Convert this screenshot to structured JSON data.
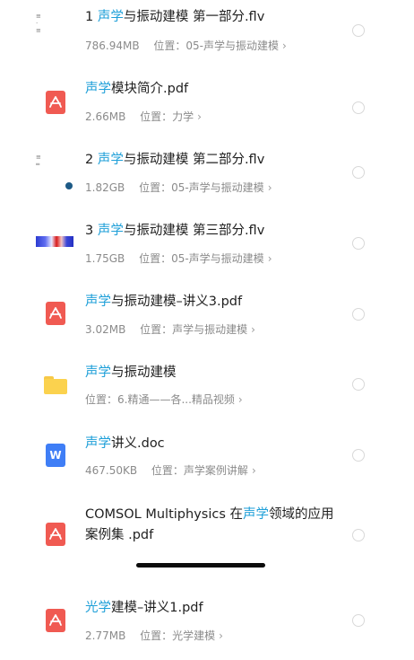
{
  "files": [
    {
      "icon": "video-thumbnail",
      "name_num": "1 ",
      "name_hl": "声学",
      "name_rest": "与振动建模 第一部分.flv",
      "size": "786.94MB",
      "location": "位置：05-声学与振动建模"
    },
    {
      "icon": "pdf-icon",
      "name_num": "",
      "name_hl": "声学",
      "name_rest": "模块简介.pdf",
      "size": "2.66MB",
      "location": "位置：力学"
    },
    {
      "icon": "video-thumbnail",
      "name_num": "2 ",
      "name_hl": "声学",
      "name_rest": "与振动建模 第二部分.flv",
      "size": "1.82GB",
      "location": "位置：05-声学与振动建模"
    },
    {
      "icon": "video-thumbnail",
      "name_num": "3 ",
      "name_hl": "声学",
      "name_rest": "与振动建模 第三部分.flv",
      "size": "1.75GB",
      "location": "位置：05-声学与振动建模"
    },
    {
      "icon": "pdf-icon",
      "name_num": "",
      "name_hl": "声学",
      "name_rest": "与振动建模–讲义3.pdf",
      "size": "3.02MB",
      "location": "位置：声学与振动建模"
    },
    {
      "icon": "folder-icon",
      "name_num": "",
      "name_hl": "声学",
      "name_rest": "与振动建模",
      "size": "",
      "location": "位置：6.精通——各...精品视频"
    },
    {
      "icon": "word-icon",
      "name_num": "",
      "name_hl": "声学",
      "name_rest": "讲义.doc",
      "size": "467.50KB",
      "location": "位置：声学案例讲解"
    },
    {
      "icon": "pdf-icon",
      "name_line1_pre": "COMSOL Multiphysics 在",
      "name_hl": "声学",
      "name_line1_post": "领域的应用",
      "name_line2": "案例集 .pdf"
    },
    {
      "icon": "pdf-icon",
      "name_num": "",
      "name_hl": "光学",
      "name_rest": "建模–讲义1.pdf",
      "size": "2.77MB",
      "location": "位置：光学建模"
    }
  ],
  "chevron": "›",
  "word_letter": "W",
  "thumb_text": {
    "t1": "≡\n≡",
    "t2": "≡"
  }
}
